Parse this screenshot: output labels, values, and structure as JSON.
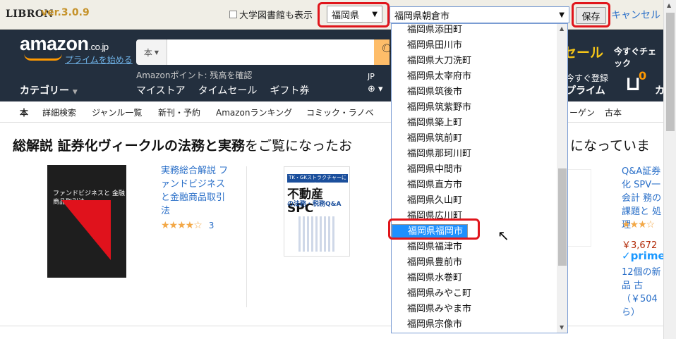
{
  "libron": {
    "logo": "LIBRON",
    "version": "ver.3.0.9",
    "university_checkbox": "大学図書館も表示",
    "prefecture": "福岡県",
    "city": "福岡県朝倉市",
    "save": "保存",
    "cancel": "キャンセル"
  },
  "amazon": {
    "logo": "amazon",
    "tld": ".co.jp",
    "prime_link": "プライムを始める",
    "search_category": "本",
    "search_placeholder": "",
    "points": "Amazonポイント: 残高を確認",
    "categories": "カテゴリー",
    "nav_links": [
      "マイストア",
      "タイムセール",
      "ギフト券"
    ],
    "lang": "JP",
    "sale": "セール",
    "check": "今すぐチェック",
    "register": "今すぐ登録",
    "prime": "プライム",
    "cart_count": "0",
    "cart_label": "カ"
  },
  "subnav": [
    "本",
    "詳細検索",
    "ジャンル一覧",
    "新刊・予約",
    "Amazonランキング",
    "コミック・ラノベ",
    "ーゲン",
    "古本"
  ],
  "main": {
    "viewing_bold": "総解説 証券化ヴィークルの法務と実務",
    "viewing_rest": "をご覧になったお",
    "viewing_tail": "になっていま",
    "book1": {
      "cover_text": "ファンドビジネスと 金融商品取引法",
      "title": "実務総合解説 ファンドビジネスと金融商品取引法",
      "stars": "★★★★☆",
      "rating_count": "3"
    },
    "book2": {
      "cover_banner": "TK・GKストラクチャーによる",
      "cover_title": "不動産SPC",
      "cover_sub": "の法務・税務Q&A"
    },
    "book4": {
      "title": "Q&A証券化 SPV一会計 務の課題と 処理",
      "stars": "★★★☆",
      "price": "￥3,672",
      "prime": "✓prime",
      "new": "12個の新品 古（￥504 ら）"
    }
  },
  "dropdown": {
    "items": [
      "福岡県添田町",
      "福岡県田川市",
      "福岡県大刀洗町",
      "福岡県太宰府市",
      "福岡県筑後市",
      "福岡県筑紫野市",
      "福岡県築上町",
      "福岡県筑前町",
      "福岡県那珂川町",
      "福岡県中間市",
      "福岡県直方市",
      "福岡県久山町",
      "福岡県広川町",
      "福岡県福岡市",
      "福岡県福智町",
      "福岡県福津市",
      "福岡県豊前市",
      "福岡県水巻町",
      "福岡県みやこ町",
      "福岡県みやま市",
      "福岡県宗像市"
    ],
    "selected": "福岡県福岡市"
  },
  "colors": {
    "highlight_ring": "#e0151b",
    "amazon_dark": "#232f3e",
    "link": "#2a6fc8",
    "selection": "#1e90ff"
  }
}
